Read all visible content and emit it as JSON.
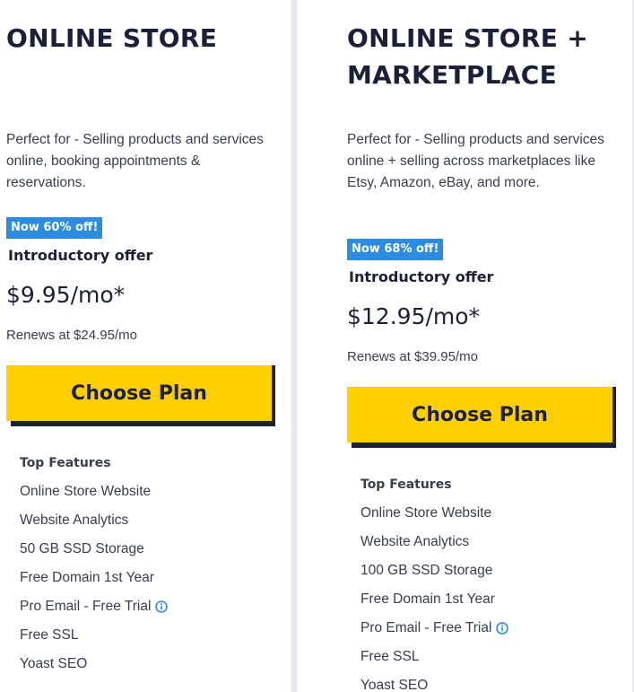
{
  "plans": [
    {
      "title": "ONLINE STORE",
      "description": "Perfect for - Selling products and services online, booking appointments & reservations.",
      "badge": "Now 60% off!",
      "intro": "Introductory offer",
      "price": "$9.95/mo*",
      "renews": "Renews at $24.95/mo",
      "cta": "Choose Plan",
      "features_heading": "Top Features",
      "features": [
        "Online Store Website",
        "Website Analytics",
        "50 GB SSD Storage",
        "Free Domain 1st Year",
        "Pro Email - Free Trial",
        "Free SSL",
        "Yoast SEO"
      ]
    },
    {
      "title": "ONLINE STORE + MARKETPLACE",
      "description": "Perfect for - Selling products and services online + selling across marketplaces like Etsy, Amazon, eBay, and more.",
      "badge": "Now 68% off!",
      "intro": "Introductory offer",
      "price": "$12.95/mo*",
      "renews": "Renews at $39.95/mo",
      "cta": "Choose Plan",
      "features_heading": "Top Features",
      "features": [
        "Online Store Website",
        "Website Analytics",
        "100 GB SSD Storage",
        "Free Domain 1st Year",
        "Pro Email - Free Trial",
        "Free SSL",
        "Yoast SEO"
      ]
    }
  ],
  "colors": {
    "accent_yellow": "#ffcf00",
    "badge_blue": "#2e8ce0",
    "navy": "#1b2038"
  },
  "icons": {
    "info": "info-circle-icon"
  }
}
